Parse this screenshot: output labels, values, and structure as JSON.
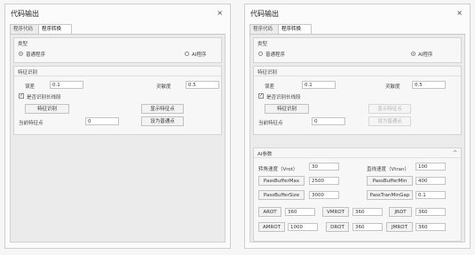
{
  "left": {
    "title": "代码输出",
    "close": "×",
    "tabs": [
      "程序代码",
      "程序转换"
    ],
    "type_group": {
      "header": "类型",
      "normal": "普通程序",
      "ai": "AI程序"
    },
    "feature_group": {
      "header": "特征识别",
      "error_label": "误差",
      "error_value": "0.1",
      "sensitivity_label": "灵敏度",
      "sensitivity_value": "0.5",
      "long_line_label": "是否识别长线段",
      "recognize_button": "特征识别",
      "show_button": "显示特征点",
      "current_label": "当前特征点",
      "current_value": "0",
      "set_normal_button": "设为普通点"
    }
  },
  "right": {
    "title": "代码输出",
    "close": "×",
    "tabs": [
      "程序代码",
      "程序转换"
    ],
    "type_group": {
      "header": "类型",
      "normal": "普通程序",
      "ai": "AI程序"
    },
    "feature_group": {
      "header": "特征识别",
      "error_label": "误差",
      "error_value": "0.1",
      "sensitivity_label": "灵敏度",
      "sensitivity_value": "0.5",
      "long_line_label": "是否识别长线段",
      "recognize_button": "特征识别",
      "show_button": "显示特征点",
      "current_label": "当前特征点",
      "current_value": "0",
      "set_normal_button": "设为普通点"
    },
    "ai_group": {
      "header": "AI参数",
      "collapse": "^",
      "vrot_label": "转角速度（Vrot）",
      "vrot_value": "30",
      "vtran_label": "直线速度（Vtran）",
      "vtran_value": "100",
      "pbmax_button": "PassBufferMax",
      "pbmax_value": "2500",
      "pbmin_button": "PassBufferMin",
      "pbmin_value": "400",
      "pbsize_button": "PassBufferSize",
      "pbsize_value": "3000",
      "ptmingap_button": "PassTranMinGap",
      "ptmingap_value": "0.1",
      "arot_button": "AROT",
      "arot_value": "360",
      "vmrot_button": "VMROT",
      "vmrot_value": "360",
      "jrot_button": "JROT",
      "jrot_value": "360",
      "amrot_button": "AMROT",
      "amrot_value": "1000",
      "drot_button": "DROT",
      "drot_value": "360",
      "jmrot_button": "JMROT",
      "jmrot_value": "360"
    }
  }
}
